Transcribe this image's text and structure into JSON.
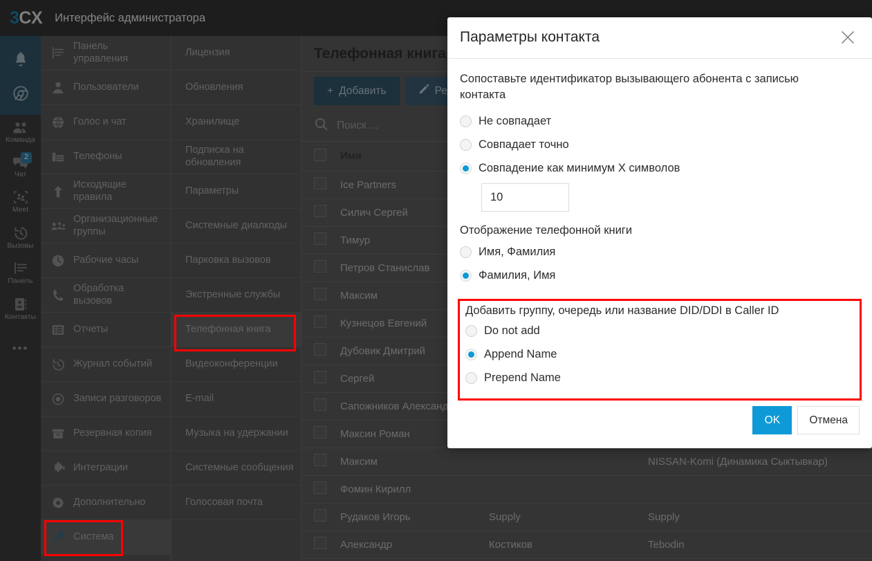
{
  "header": {
    "logo_3": "3",
    "logo_cx": "CX",
    "title": "Интерфейс администратора"
  },
  "rail": {
    "items": [
      {
        "icon": "bell-icon",
        "label": ""
      },
      {
        "icon": "chrome-icon",
        "label": ""
      },
      {
        "icon": "team-icon",
        "label": "Команда"
      },
      {
        "icon": "chat-icon",
        "label": "Чат",
        "badge": "2"
      },
      {
        "icon": "meet-icon",
        "label": "Meet"
      },
      {
        "icon": "call-history-icon",
        "label": "Вызовы"
      },
      {
        "icon": "panel-icon",
        "label": "Панель"
      },
      {
        "icon": "contacts-icon",
        "label": "Контакты"
      },
      {
        "icon": "more-dots-icon",
        "label": ""
      }
    ]
  },
  "nav_primary": {
    "items": [
      {
        "icon": "dashboard-icon",
        "label": "Панель управления"
      },
      {
        "icon": "user-icon",
        "label": "Пользователи"
      },
      {
        "icon": "globe-icon",
        "label": "Голос и чат"
      },
      {
        "icon": "desk-phone-icon",
        "label": "Телефоны"
      },
      {
        "icon": "arrow-up-icon",
        "label": "Исходящие правила"
      },
      {
        "icon": "group-icon",
        "label": "Организационные группы"
      },
      {
        "icon": "clock-icon",
        "label": "Рабочие часы"
      },
      {
        "icon": "handset-icon",
        "label": "Обработка вызовов"
      },
      {
        "icon": "report-icon",
        "label": "Отчеты"
      },
      {
        "icon": "event-log-icon",
        "label": "Журнал событий"
      },
      {
        "icon": "record-icon",
        "label": "Записи разговоров"
      },
      {
        "icon": "archive-icon",
        "label": "Резервная копия"
      },
      {
        "icon": "puzzle-icon",
        "label": "Интеграции"
      },
      {
        "icon": "gear-icon",
        "label": "Дополнительно"
      },
      {
        "icon": "wrench-icon",
        "label": "Система",
        "active": true
      }
    ]
  },
  "nav_secondary": {
    "items": [
      {
        "label": "Лицензия"
      },
      {
        "label": "Обновления"
      },
      {
        "label": "Хранилище"
      },
      {
        "label": "Подписка на обновления"
      },
      {
        "label": "Параметры"
      },
      {
        "label": "Системные диалкоды"
      },
      {
        "label": "Парковка вызовов"
      },
      {
        "label": "Экстренные службы"
      },
      {
        "label": "Телефонная книга",
        "active": true
      },
      {
        "label": "Видеоконференции"
      },
      {
        "label": "E-mail"
      },
      {
        "label": "Музыка на удержании"
      },
      {
        "label": "Системные сообщения"
      },
      {
        "label": "Голосовая почта"
      }
    ]
  },
  "main": {
    "page_title": "Телефонная книга",
    "toolbar": {
      "add_label": "Добавить",
      "add_icon": "plus-icon",
      "edit_label": "Ред",
      "edit_icon": "pencil-icon"
    },
    "search": {
      "icon": "search-icon",
      "placeholder": "Поиск ...",
      "value": ""
    },
    "table": {
      "columns": [
        "",
        "Имя",
        "",
        ""
      ],
      "header_name": "Имя",
      "rows": [
        {
          "name": "Ice Partners",
          "last": "",
          "company": ""
        },
        {
          "name": "Силич Сергей",
          "last": "",
          "company": ""
        },
        {
          "name": "Тимур",
          "last": "",
          "company": ""
        },
        {
          "name": "Петров Станислав",
          "last": "",
          "company": ""
        },
        {
          "name": "Максим",
          "last": "",
          "company": ""
        },
        {
          "name": "Кузнецов Евгений",
          "last": "",
          "company": ""
        },
        {
          "name": "Дубовик Дмитрий",
          "last": "",
          "company": ""
        },
        {
          "name": "Сергей",
          "last": "",
          "company": ""
        },
        {
          "name": "Сапожников Александр",
          "last": "",
          "company": ""
        },
        {
          "name": "Максин Роман",
          "last": "",
          "company": ""
        },
        {
          "name": "Максим",
          "last": "",
          "company": "NISSAN-Komi (Динамика Сыктывкар)"
        },
        {
          "name": "Фомин Кирилл",
          "last": "",
          "company": ""
        },
        {
          "name": "Рудаков Игорь",
          "last": "Supply",
          "company": "Supply"
        },
        {
          "name": "Александр",
          "last": "Костиков",
          "company": "Tebodin"
        }
      ]
    }
  },
  "modal": {
    "title": "Параметры контакта",
    "close_icon": "close-icon",
    "match_description": "Сопоставьте идентификатор вызывающего абонента с записью контакта",
    "match_options": [
      {
        "label": "Не совпадает",
        "selected": false
      },
      {
        "label": "Совпадает точно",
        "selected": false
      },
      {
        "label": "Совпадение как минимум X символов",
        "selected": true
      }
    ],
    "min_chars_value": "10",
    "display_section_label": "Отображение телефонной книги",
    "display_options": [
      {
        "label": "Имя, Фамилия",
        "selected": false
      },
      {
        "label": "Фамилия, Имя",
        "selected": true
      }
    ],
    "caller_id_section_label": "Добавить группу, очередь или название DID/DDI в Caller ID",
    "caller_id_options": [
      {
        "label": "Do not add",
        "selected": false
      },
      {
        "label": "Append Name",
        "selected": true
      },
      {
        "label": "Prepend Name",
        "selected": false
      }
    ],
    "ok_label": "OK",
    "cancel_label": "Отмена"
  },
  "colors": {
    "accent_blue": "#0e9ad6",
    "brand_teal": "#2f5366",
    "highlight_red": "#ff0000",
    "topbar_dark": "#333333"
  }
}
